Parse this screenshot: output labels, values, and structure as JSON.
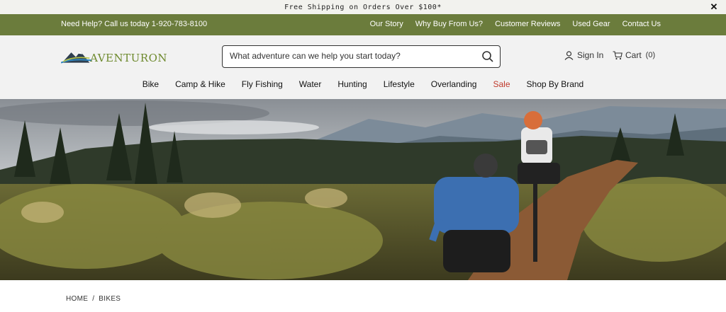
{
  "promo": {
    "text": "Free Shipping on Orders Over $100*",
    "close_icon": "close-icon"
  },
  "utility": {
    "help_text": "Need Help? Call us today 1-920-783-8100",
    "links": [
      "Our Story",
      "Why Buy From Us?",
      "Customer Reviews",
      "Used Gear",
      "Contact Us"
    ]
  },
  "header": {
    "logo_text": "AVENTURON",
    "search_placeholder": "What adventure can we help you start today?",
    "search_icon": "search-icon",
    "signin_label": "Sign In",
    "cart_label": "Cart",
    "cart_count": "(0)"
  },
  "nav": {
    "items": [
      "Bike",
      "Camp & Hike",
      "Fly Fishing",
      "Water",
      "Hunting",
      "Lifestyle",
      "Overlanding",
      "Sale",
      "Shop By Brand"
    ]
  },
  "breadcrumb": {
    "home": "HOME",
    "separator": "/",
    "current": "BIKES"
  },
  "colors": {
    "utility_bg": "#6b7c3c",
    "logo_green": "#6e8a2e",
    "sale_red": "#c0392b"
  }
}
